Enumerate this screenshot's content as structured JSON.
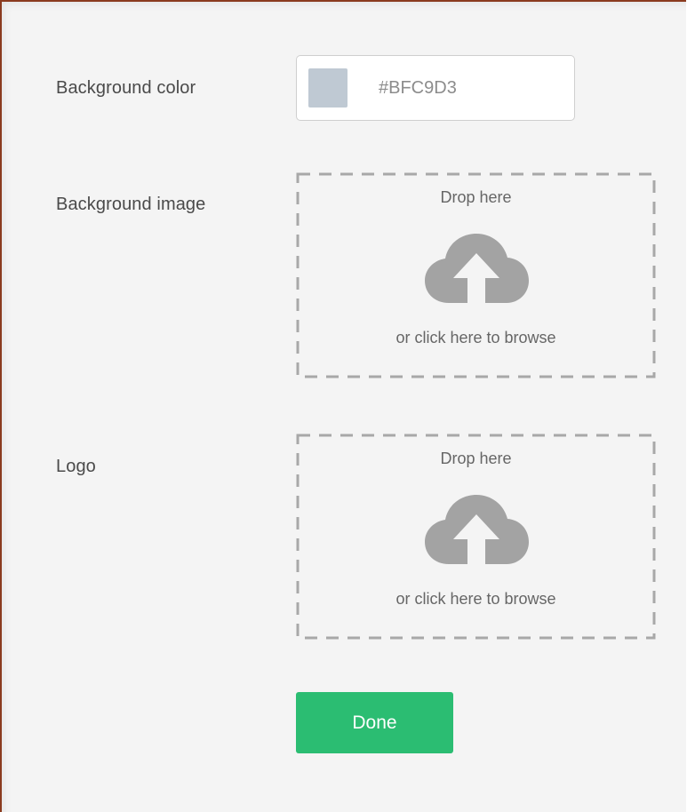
{
  "form": {
    "background_color": {
      "label": "Background color",
      "value": "#BFC9D3",
      "swatch": "#BFC9D3"
    },
    "background_image": {
      "label": "Background image",
      "drop_text": "Drop here",
      "browse_text": "or click here to browse",
      "icon": "cloud-upload-icon"
    },
    "logo": {
      "label": "Logo",
      "drop_text": "Drop here",
      "browse_text": "or click here to browse",
      "icon": "cloud-upload-icon"
    },
    "done_label": "Done"
  },
  "colors": {
    "accent": "#2BBD72",
    "icon": "#A3A3A3",
    "dash": "#A8A8A8",
    "panel": "#F4F4F4"
  }
}
